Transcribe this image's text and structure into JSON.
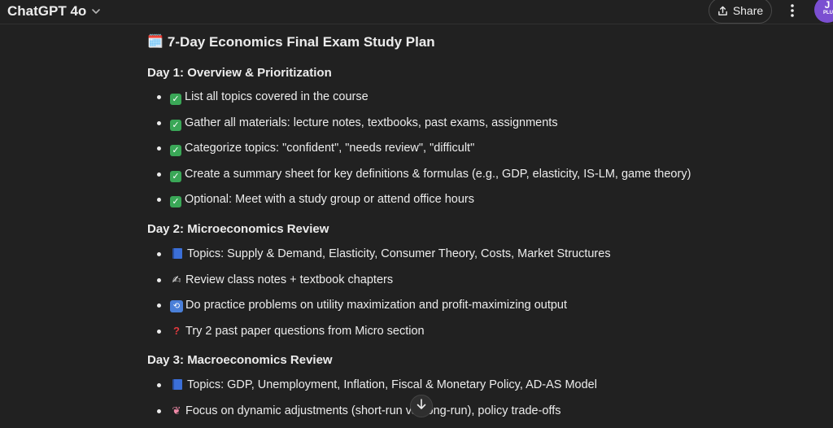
{
  "header": {
    "model_label": "ChatGPT 4o",
    "share_label": "Share",
    "avatar_initial": "J",
    "avatar_sub": "PLU"
  },
  "doc": {
    "title": "7-Day Economics Final Exam Study Plan",
    "days": [
      {
        "title": "Day 1: Overview & Prioritization",
        "items": [
          {
            "icon": "check-mark-icon",
            "text": "List all topics covered in the course"
          },
          {
            "icon": "check-mark-icon",
            "text": "Gather all materials: lecture notes, textbooks, past exams, assignments"
          },
          {
            "icon": "check-mark-icon",
            "text": "Categorize topics: \"confident\", \"needs review\", \"difficult\""
          },
          {
            "icon": "check-mark-icon",
            "text": "Create a summary sheet for key definitions & formulas (e.g., GDP, elasticity, IS-LM, game theory)"
          },
          {
            "icon": "check-mark-icon",
            "text": "Optional: Meet with a study group or attend office hours"
          }
        ]
      },
      {
        "title": "Day 2: Microeconomics Review",
        "items": [
          {
            "icon": "book-icon",
            "text": "Topics: Supply & Demand, Elasticity, Consumer Theory, Costs, Market Structures"
          },
          {
            "icon": "writing-hand-icon",
            "text": "Review class notes + textbook chapters"
          },
          {
            "icon": "repeat-icon",
            "text": "Do practice problems on utility maximization and profit-maximizing output"
          },
          {
            "icon": "question-mark-icon",
            "text": "Try 2 past paper questions from Micro section"
          }
        ]
      },
      {
        "title": "Day 3: Macroeconomics Review",
        "items": [
          {
            "icon": "book-icon",
            "text": "Topics: GDP, Unemployment, Inflation, Fiscal & Monetary Policy, AD-AS Model"
          },
          {
            "icon": "brain-icon",
            "text": "Focus on dynamic adjustments (short-run vs. long-run), policy trade-offs"
          }
        ]
      }
    ]
  }
}
